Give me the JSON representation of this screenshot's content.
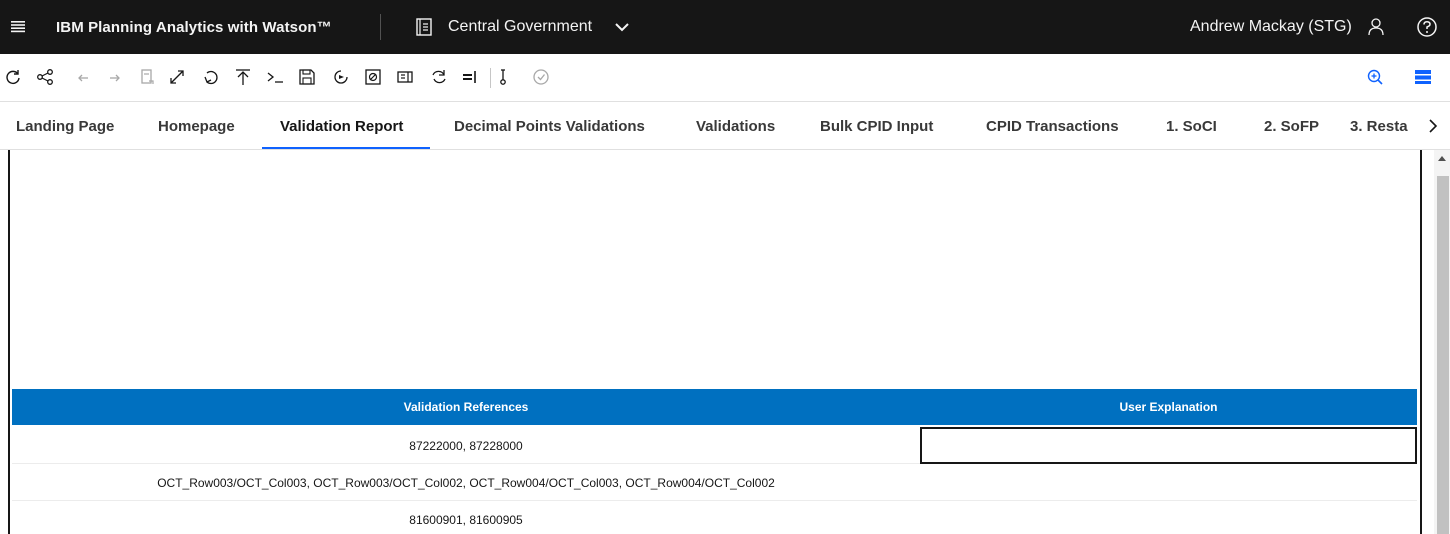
{
  "header": {
    "product_name": "IBM Planning Analytics with Watson™",
    "workspace": "Central Government",
    "user": "Andrew Mackay (STG)"
  },
  "toolbar": {
    "buttons": [
      "refresh-icon",
      "share-icon",
      "undo-icon",
      "redo-icon",
      "copy-view-icon",
      "expand-icon",
      "rollback-icon",
      "upload-icon",
      "console-icon",
      "save-icon",
      "run-icon",
      "link-icon",
      "edit-icon",
      "sync-icon",
      "align-icon",
      "measure-icon",
      "check-icon",
      "zoom-in-icon",
      "stack-icon"
    ]
  },
  "tabs": [
    {
      "label": "Landing Page"
    },
    {
      "label": "Homepage"
    },
    {
      "label": "Validation Report",
      "active": true
    },
    {
      "label": "Decimal Points Validations"
    },
    {
      "label": "Validations"
    },
    {
      "label": "Bulk CPID Input"
    },
    {
      "label": "CPID Transactions"
    },
    {
      "label": "1. SoCI"
    },
    {
      "label": "2. SoFP"
    },
    {
      "label": "3. Resta"
    }
  ],
  "table": {
    "headers": [
      "Validation References",
      "User Explanation"
    ],
    "rows": [
      {
        "references": "87222000, 87228000",
        "explanation": ""
      },
      {
        "references": "OCT_Row003/OCT_Col003, OCT_Row003/OCT_Col002, OCT_Row004/OCT_Col003, OCT_Row004/OCT_Col002",
        "explanation": ""
      },
      {
        "references": "81600901, 81600905",
        "explanation": ""
      }
    ]
  },
  "colors": {
    "topbar": "#161616",
    "header_blue": "#0070c0",
    "accent": "#0f62fe"
  }
}
